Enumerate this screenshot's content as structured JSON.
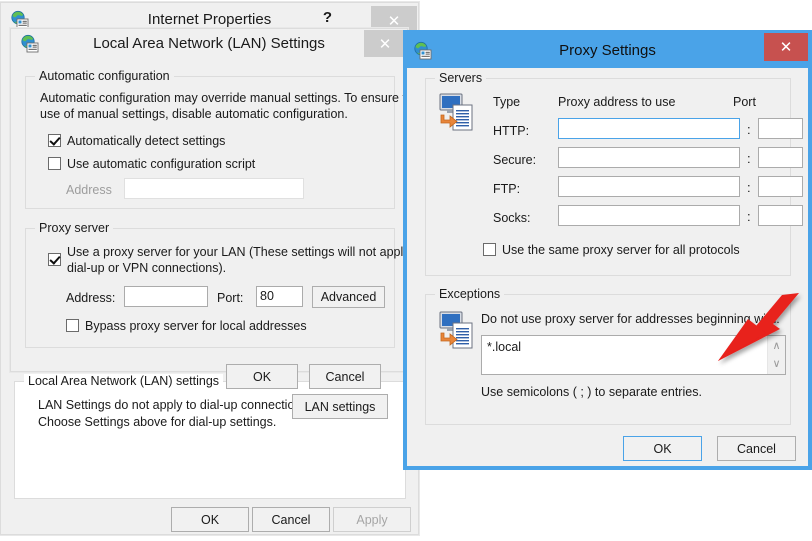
{
  "internet_properties": {
    "title": "Internet Properties",
    "icon": "internet-properties-icon",
    "help_label": "?",
    "close_label": "✕",
    "lan_group": {
      "legend": "Local Area Network (LAN) settings",
      "description_line1": "LAN Settings do not apply to dial-up connections.",
      "description_line2": "Choose Settings above for dial-up settings.",
      "lan_settings_button": "LAN settings"
    },
    "buttons": {
      "ok": "OK",
      "cancel": "Cancel",
      "apply": "Apply"
    }
  },
  "lan_settings": {
    "title": "Local Area Network (LAN) Settings",
    "icon": "internet-properties-icon",
    "close_label": "✕",
    "automatic_configuration": {
      "legend": "Automatic configuration",
      "description_line1": "Automatic configuration may override manual settings.  To ensure the",
      "description_line2": "use of manual settings, disable automatic configuration.",
      "auto_detect_label": "Automatically detect settings",
      "auto_detect_checked": true,
      "use_script_label": "Use automatic configuration script",
      "use_script_checked": false,
      "address_label": "Address",
      "address_value": "",
      "address_enabled": false
    },
    "proxy_server": {
      "legend": "Proxy server",
      "use_proxy_label_line1": "Use a proxy server for your LAN (These settings will not apply to",
      "use_proxy_label_line2": "dial-up or VPN connections).",
      "use_proxy_checked": true,
      "address_label": "Address:",
      "address_value": "",
      "port_label": "Port:",
      "port_value": "80",
      "advanced_button": "Advanced",
      "bypass_label": "Bypass proxy server for local addresses",
      "bypass_checked": false
    },
    "buttons": {
      "ok": "OK",
      "cancel": "Cancel"
    }
  },
  "proxy_settings": {
    "title": "Proxy Settings",
    "icon": "internet-properties-icon",
    "close_label": "✕",
    "titlebar_color": "#4aa3e8",
    "close_color": "#c7514f",
    "servers": {
      "legend": "Servers",
      "icon": "proxy-servers-icon",
      "column_type": "Type",
      "column_address": "Proxy address to use",
      "column_port": "Port",
      "separator": ":",
      "rows": [
        {
          "type": "HTTP:",
          "address": "",
          "port": "",
          "focused": true
        },
        {
          "type": "Secure:",
          "address": "",
          "port": "",
          "focused": false
        },
        {
          "type": "FTP:",
          "address": "",
          "port": "",
          "focused": false
        },
        {
          "type": "Socks:",
          "address": "",
          "port": "",
          "focused": false
        }
      ],
      "same_proxy_label": "Use the same proxy server for all protocols",
      "same_proxy_checked": false
    },
    "exceptions": {
      "legend": "Exceptions",
      "icon": "proxy-exceptions-icon",
      "description": "Do not use proxy server for addresses beginning with:",
      "value": "*.local",
      "hint": "Use semicolons ( ; ) to separate entries.",
      "scroll_up": "∧",
      "scroll_down": "∨"
    },
    "buttons": {
      "ok": "OK",
      "cancel": "Cancel"
    }
  },
  "annotation": {
    "arrow_color": "#e8201f",
    "name": "red-pointer-arrow"
  }
}
